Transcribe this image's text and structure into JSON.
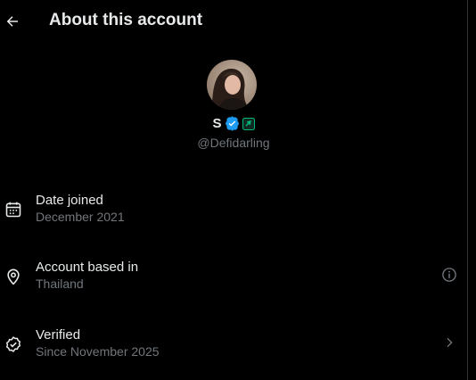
{
  "header": {
    "title": "About this account",
    "back_icon": "arrow-left-icon"
  },
  "profile": {
    "display_name": "S",
    "handle": "@Defidarling",
    "verified_color": "#1d9bf0",
    "affiliate_badge_color": "#00ba7c"
  },
  "rows": [
    {
      "label": "Date joined",
      "value": "December 2021",
      "icon": "calendar-icon"
    },
    {
      "label": "Account based in",
      "value": "Thailand",
      "icon": "location-pin-icon",
      "action_icon": "info-icon"
    },
    {
      "label": "Verified",
      "value": "Since November 2025",
      "icon": "verified-check-icon",
      "action_icon": "chevron-right-icon"
    }
  ],
  "colors": {
    "background": "#000000",
    "primary_text": "#e7e9ea",
    "secondary_text": "#71767b"
  }
}
